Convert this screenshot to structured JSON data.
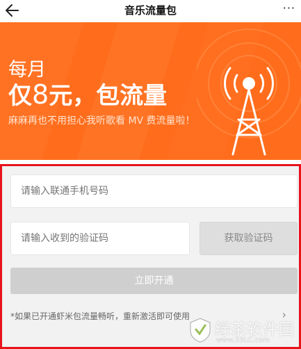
{
  "header": {
    "title": "音乐流量包",
    "more_label": "···"
  },
  "banner": {
    "line1": "每月",
    "line2_prefix": "仅",
    "line2_number": "8",
    "line2_suffix": "元，包流量",
    "subtitle": "麻麻再也不用担心我听歌看 MV 费流量啦！",
    "bg_color": "#ff6d1c"
  },
  "form": {
    "phone_placeholder": "请输入联通手机号码",
    "code_placeholder": "请输入收到的验证码",
    "get_code_label": "获取验证码",
    "submit_label": "立即开通",
    "note": "*如果已开通虾米包流量畅听，重新激活即可使用",
    "highlight_color": "#e8121b"
  },
  "watermark": {
    "text": "绿茶软件园",
    "url": "www.33LC.com"
  },
  "icons": {
    "back": "arrow-left-icon",
    "more": "more-dots-icon",
    "tower": "signal-tower-icon",
    "chevron": "chevron-right-icon"
  }
}
